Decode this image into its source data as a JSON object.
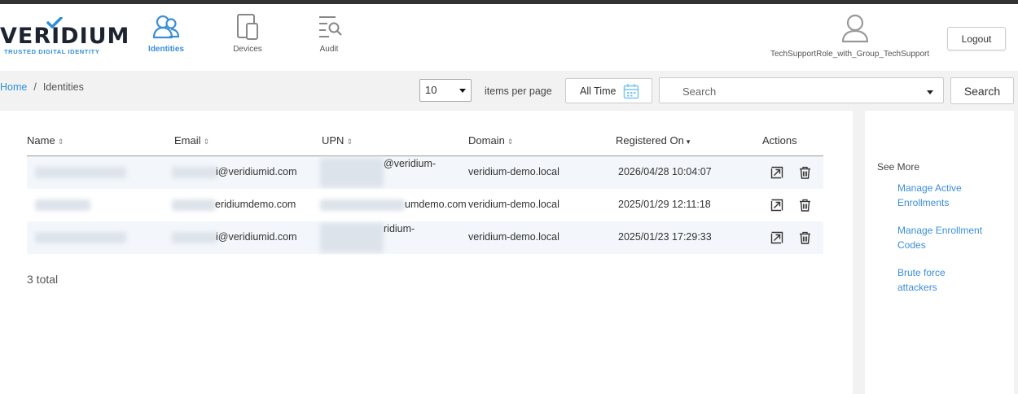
{
  "brand": {
    "name": "VERIDIUM",
    "tagline": "TRUSTED DIGITAL IDENTITY",
    "accent": "#3b8ed8"
  },
  "nav": [
    {
      "label": "Identities",
      "icon": "users-icon",
      "active": true
    },
    {
      "label": "Devices",
      "icon": "devices-icon",
      "active": false
    },
    {
      "label": "Audit",
      "icon": "audit-icon",
      "active": false
    }
  ],
  "user": {
    "role": "TechSupportRole_with_Group_TechSupport",
    "logout_label": "Logout"
  },
  "breadcrumb": {
    "home": "Home",
    "separator": "/",
    "current": "Identities"
  },
  "toolbar": {
    "per_page_value": "10",
    "per_page_label": "items per page",
    "date_filter": "All Time",
    "search_placeholder": "Search",
    "search_button": "Search"
  },
  "table": {
    "columns": [
      "Name",
      "Email",
      "UPN",
      "Domain",
      "Registered On",
      "Actions"
    ],
    "rows": [
      {
        "email_suffix": "i@veridiumid.com",
        "upn_suffix": "@veridium-",
        "domain": "veridium-demo.local",
        "registered": "2026/04/28 10:04:07"
      },
      {
        "email_suffix": "eridiumdemo.com",
        "upn_suffix": "umdemo.com",
        "domain": "veridium-demo.local",
        "registered": "2025/01/29 12:11:18"
      },
      {
        "email_suffix": "i@veridiumid.com",
        "upn_suffix": "ridium-",
        "domain": "veridium-demo.local",
        "registered": "2025/01/23 17:29:33"
      }
    ],
    "total": "3 total"
  },
  "sidebar": {
    "heading": "See More",
    "links": [
      {
        "line1": "Manage Active",
        "line2": "Enrollments"
      },
      {
        "line1": "Manage Enrollment",
        "line2": "Codes"
      },
      {
        "line1": "Brute force",
        "line2": "attackers"
      }
    ]
  }
}
